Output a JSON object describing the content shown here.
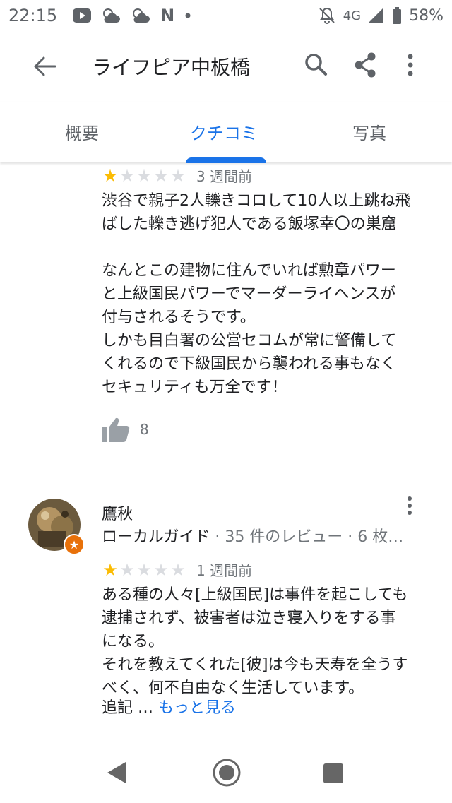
{
  "status_bar": {
    "time": "22:15",
    "network": "4G",
    "battery": "58%",
    "icons": [
      "youtube-icon",
      "weather-icon",
      "weather-icon",
      "netflix-icon",
      "dot-icon",
      "mute-icon",
      "signal-icon",
      "battery-icon"
    ],
    "netflix_glyph": "N"
  },
  "app_bar": {
    "title": "ライフピア中板橋"
  },
  "tabs": [
    {
      "label": "概要"
    },
    {
      "label": "クチコミ"
    },
    {
      "label": "写真"
    }
  ],
  "active_tab": "クチコミ",
  "colors": {
    "accent": "#1a73e8",
    "star": "#fbbc04",
    "guide_badge": "#e8710a"
  },
  "reviews": [
    {
      "rating": 1,
      "max_rating": 5,
      "relative_date": "3 週間前",
      "text": "渋谷で親子2人轢きコロして10人以上跳ね飛\nばした轢き逃げ犯人である飯塚幸〇の巣窟\n\nなんとこの建物に住んでいれば勲章パワー\nと上級国民パワーでマーダーライヘンスが\n付与されるそうです。\nしかも目白署の公営セコムが常に警備して\nくれるので下級国民から襲われる事もなく\nセキュリティも万全です！",
      "likes": "8"
    },
    {
      "author": "鷹秋",
      "author_level": "ローカルガイド",
      "author_stats": " · 35 件のレビュー · 6 枚の…",
      "rating": 1,
      "max_rating": 5,
      "relative_date": "1 週間前",
      "text": "ある種の人々[上級国民]は事件を起こしても\n逮捕されず、被害者は泣き寝入りをする事\nになる。\nそれを教えてくれた[彼]は今も天寿を全うす\nべく、何不自由なく生活しています。",
      "text_tail": "追記 … ",
      "more_label": "もっと見る"
    }
  ]
}
